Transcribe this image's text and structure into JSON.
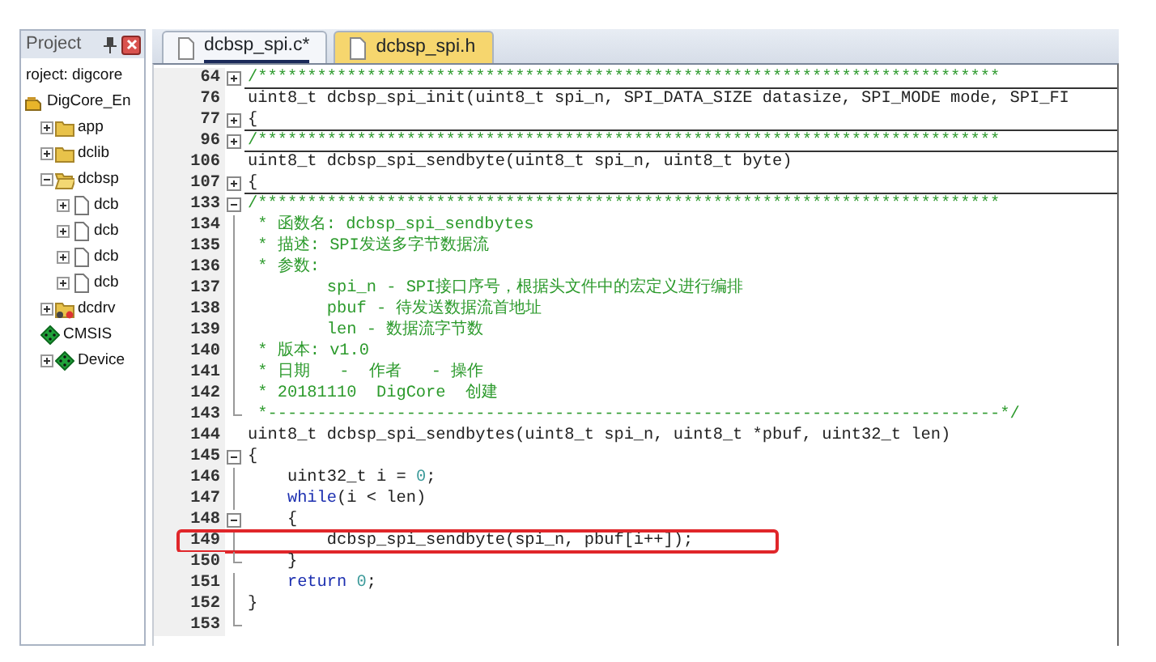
{
  "project_panel": {
    "title": "Project",
    "tree": [
      {
        "label": "roject: digcore",
        "children": [
          {
            "label": "DigCore_En",
            "kind": "target",
            "children": [
              {
                "label": "app",
                "kind": "folder",
                "expanded": false
              },
              {
                "label": "dclib",
                "kind": "folder",
                "expanded": false
              },
              {
                "label": "dcbsp",
                "kind": "folder-open",
                "expanded": true,
                "children": [
                  {
                    "label": "dcb",
                    "kind": "file",
                    "expanded": false
                  },
                  {
                    "label": "dcb",
                    "kind": "file",
                    "expanded": false
                  },
                  {
                    "label": "dcb",
                    "kind": "file",
                    "expanded": false
                  },
                  {
                    "label": "dcb",
                    "kind": "file",
                    "expanded": false
                  }
                ]
              },
              {
                "label": "dcdrv",
                "kind": "folder-driver",
                "expanded": false
              },
              {
                "label": "CMSIS",
                "kind": "component"
              },
              {
                "label": "Device",
                "kind": "component",
                "expanded": false
              }
            ]
          }
        ]
      }
    ]
  },
  "tabs": [
    {
      "label": "dcbsp_spi.c*",
      "selected": true
    },
    {
      "label": "dcbsp_spi.h",
      "selected": false
    }
  ],
  "editor": {
    "lines": [
      {
        "number": "64",
        "kind": "collapsed",
        "code": [
          {
            "kind": "comment",
            "text": "/***************************************************************************"
          }
        ]
      },
      {
        "number": "76",
        "kind": "none",
        "code": [
          {
            "kind": "plain",
            "text": "uint8_t dcbsp_spi_init(uint8_t spi_n, SPI_DATA_SIZE datasize, SPI_MODE mode, SPI_FI"
          }
        ]
      },
      {
        "number": "77",
        "kind": "collapsed",
        "code": [
          {
            "kind": "plain",
            "text": "{"
          }
        ]
      },
      {
        "number": "96",
        "kind": "collapsed",
        "code": [
          {
            "kind": "comment",
            "text": "/***************************************************************************"
          }
        ]
      },
      {
        "number": "106",
        "kind": "none",
        "code": [
          {
            "kind": "plain",
            "text": "uint8_t dcbsp_spi_sendbyte(uint8_t spi_n, uint8_t byte)"
          }
        ]
      },
      {
        "number": "107",
        "kind": "collapsed",
        "code": [
          {
            "kind": "plain",
            "text": "{"
          }
        ]
      },
      {
        "number": "133",
        "kind": "expanded",
        "code": [
          {
            "kind": "comment",
            "text": "/***************************************************************************"
          }
        ]
      },
      {
        "number": "134",
        "kind": "inner",
        "code": [
          {
            "kind": "comment",
            "text": " * 函数名: dcbsp_spi_sendbytes"
          }
        ]
      },
      {
        "number": "135",
        "kind": "inner",
        "code": [
          {
            "kind": "comment",
            "text": " * 描述: SPI发送多字节数据流"
          }
        ]
      },
      {
        "number": "136",
        "kind": "inner",
        "code": [
          {
            "kind": "comment",
            "text": " * 参数:"
          }
        ]
      },
      {
        "number": "137",
        "kind": "inner",
        "code": [
          {
            "kind": "comment",
            "text": "        spi_n - SPI接口序号，根据头文件中的宏定义进行编排"
          }
        ]
      },
      {
        "number": "138",
        "kind": "inner",
        "code": [
          {
            "kind": "comment",
            "text": "        pbuf - 待发送数据流首地址"
          }
        ]
      },
      {
        "number": "139",
        "kind": "inner",
        "code": [
          {
            "kind": "comment",
            "text": "        len - 数据流字节数"
          }
        ]
      },
      {
        "number": "140",
        "kind": "inner",
        "code": [
          {
            "kind": "comment",
            "text": " * 版本: v1.0"
          }
        ]
      },
      {
        "number": "141",
        "kind": "inner",
        "code": [
          {
            "kind": "comment",
            "text": " * 日期   -  作者   - 操作"
          }
        ]
      },
      {
        "number": "142",
        "kind": "inner",
        "code": [
          {
            "kind": "comment",
            "text": " * 20181110  DigCore  创建"
          }
        ]
      },
      {
        "number": "143",
        "kind": "end",
        "code": [
          {
            "kind": "comment",
            "text": " *--------------------------------------------------------------------------*/"
          }
        ]
      },
      {
        "number": "144",
        "kind": "none",
        "code": [
          {
            "kind": "plain",
            "text": "uint8_t dcbsp_spi_sendbytes(uint8_t spi_n, uint8_t *pbuf, uint32_t len)"
          }
        ]
      },
      {
        "number": "145",
        "kind": "expanded",
        "code": [
          {
            "kind": "plain",
            "text": "{"
          }
        ]
      },
      {
        "number": "146",
        "kind": "inner",
        "code": [
          {
            "kind": "plain",
            "text": "    uint32_t i = "
          },
          {
            "kind": "number",
            "text": "0"
          },
          {
            "kind": "plain",
            "text": ";"
          }
        ]
      },
      {
        "number": "147",
        "kind": "inner",
        "code": [
          {
            "kind": "keyword",
            "text": "    while"
          },
          {
            "kind": "plain",
            "text": "(i < len)"
          }
        ]
      },
      {
        "number": "148",
        "kind": "expanded",
        "code": [
          {
            "kind": "plain",
            "text": "    {"
          }
        ]
      },
      {
        "number": "149",
        "kind": "inner",
        "highlighted": true,
        "code": [
          {
            "kind": "plain",
            "text": "        dcbsp_spi_sendbyte(spi_n, pbuf[i++]);"
          }
        ]
      },
      {
        "number": "150",
        "kind": "end",
        "code": [
          {
            "kind": "plain",
            "text": "    }"
          }
        ]
      },
      {
        "number": "151",
        "kind": "inner",
        "code": [
          {
            "kind": "keyword",
            "text": "    return "
          },
          {
            "kind": "number",
            "text": "0"
          },
          {
            "kind": "plain",
            "text": ";"
          }
        ]
      },
      {
        "number": "152",
        "kind": "inner",
        "code": [
          {
            "kind": "plain",
            "text": "}"
          }
        ]
      },
      {
        "number": "153",
        "kind": "end"
      }
    ]
  }
}
